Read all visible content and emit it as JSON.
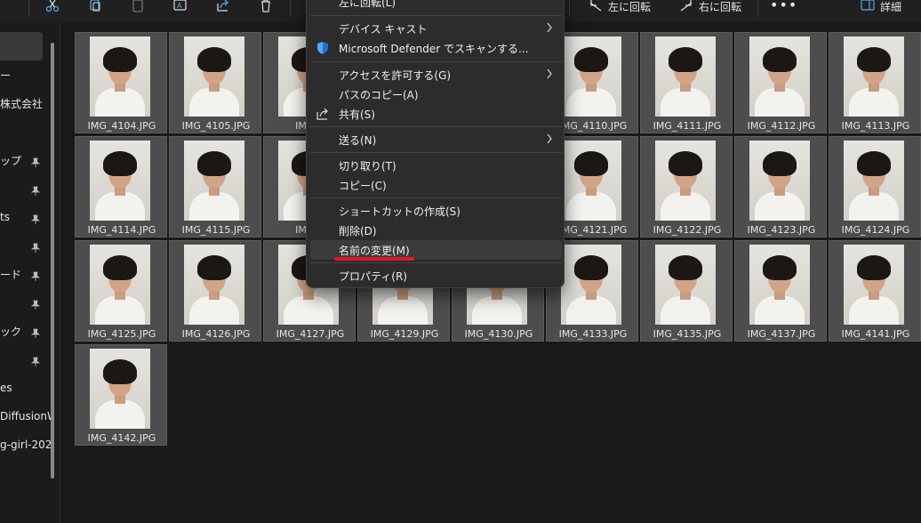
{
  "toolbar": {
    "rotate_left_label": "左に回転",
    "rotate_right_label": "右に回転",
    "more_label": "•••",
    "details_label": "詳細"
  },
  "sidebar": {
    "items": [
      {
        "label": "",
        "selected": true
      },
      {
        "label": "ー"
      },
      {
        "label": "株式会社"
      },
      {
        "label": "ップ",
        "pinned": true
      },
      {
        "label": "",
        "pinned": true
      },
      {
        "label": "ts",
        "pinned": true
      },
      {
        "label": "",
        "pinned": true
      },
      {
        "label": "ード",
        "pinned": true
      },
      {
        "label": "",
        "pinned": true
      },
      {
        "label": "ック",
        "pinned": true
      },
      {
        "label": "",
        "pinned": true
      },
      {
        "label": "es"
      },
      {
        "label": "DiffusionW"
      },
      {
        "label": "g-girl-202"
      }
    ]
  },
  "thumbnails": [
    "IMG_4104.JPG",
    "IMG_4105.JPG",
    "IMG_4",
    "",
    "",
    "IMG_4110.JPG",
    "IMG_4111.JPG",
    "IMG_4112.JPG",
    "IMG_4113.JPG",
    "IMG_4114.JPG",
    "IMG_4115.JPG",
    "IMG_4",
    "",
    "",
    "IMG_4121.JPG",
    "IMG_4122.JPG",
    "IMG_4123.JPG",
    "IMG_4124.JPG",
    "IMG_4125.JPG",
    "IMG_4126.JPG",
    "IMG_4127.JPG",
    "IMG_4129.JPG",
    "IMG_4130.JPG",
    "IMG_4133.JPG",
    "IMG_4135.JPG",
    "IMG_4137.JPG",
    "IMG_4141.JPG",
    "IMG_4142.JPG"
  ],
  "context_menu": {
    "items": [
      {
        "label": "左に回転(L)"
      },
      {
        "label": "デバイス キャスト",
        "submenu": true
      },
      {
        "label": "Microsoft Defender でスキャンする...",
        "icon": "defender-shield-icon"
      },
      {
        "label": "アクセスを許可する(G)",
        "submenu": true
      },
      {
        "label": "パスのコピー(A)"
      },
      {
        "label": "共有(S)",
        "icon": "share-icon"
      },
      {
        "label": "送る(N)",
        "submenu": true
      },
      {
        "label": "切り取り(T)"
      },
      {
        "label": "コピー(C)"
      },
      {
        "label": "ショートカットの作成(S)"
      },
      {
        "label": "削除(D)"
      },
      {
        "label": "名前の変更(M)",
        "highlighted": true
      },
      {
        "label": "プロパティ(R)"
      }
    ]
  },
  "colors": {
    "background": "#191919",
    "menu_bg": "#2c2c2c",
    "annotation_red": "#e0142b",
    "defender_blue": "#1f72d4"
  }
}
